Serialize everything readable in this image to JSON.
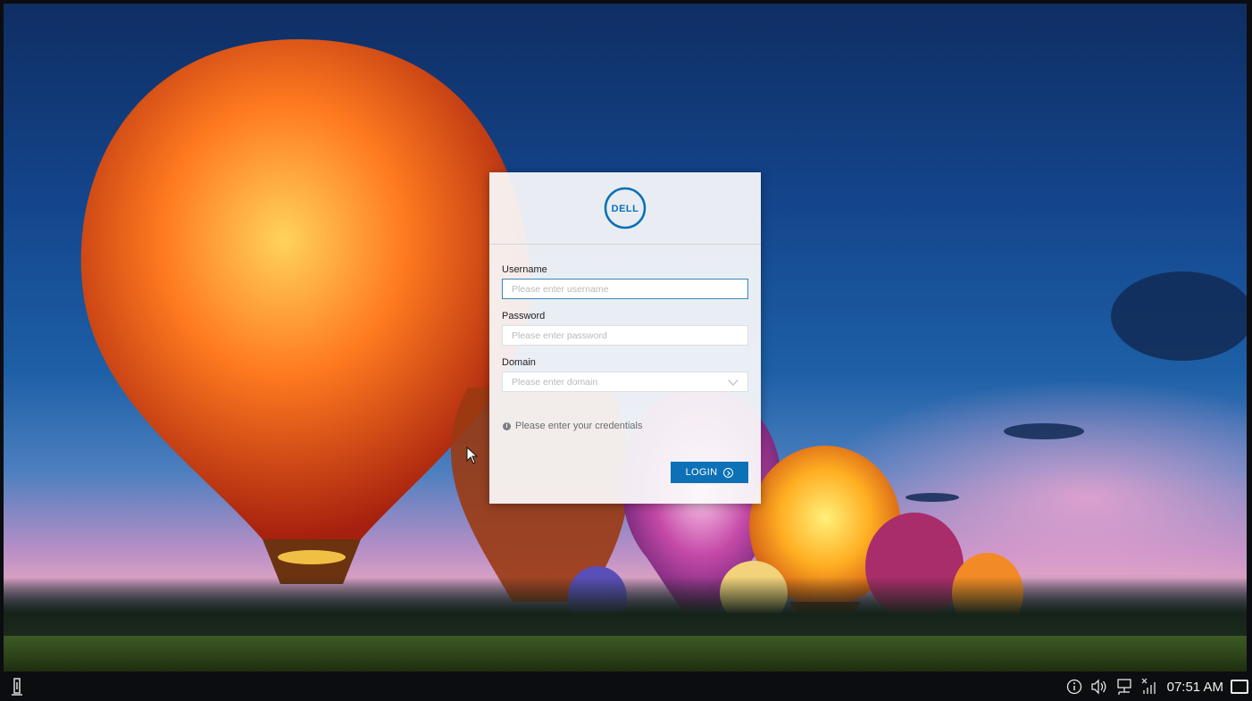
{
  "login": {
    "logo_text": "DELL",
    "username_label": "Username",
    "username_placeholder": "Please enter username",
    "password_label": "Password",
    "password_placeholder": "Please enter password",
    "domain_label": "Domain",
    "domain_placeholder": "Please enter domain",
    "message": "Please enter your credentials",
    "login_button": "LOGIN"
  },
  "taskbar": {
    "time": "07:51 AM"
  },
  "colors": {
    "accent": "#0d71b8",
    "logo_blue": "#0a6fb8"
  },
  "icons": [
    "start-icon",
    "info-icon",
    "volume-icon",
    "network-icon",
    "wireless-icon",
    "show-desktop-icon",
    "arrow-right-circle-icon"
  ]
}
